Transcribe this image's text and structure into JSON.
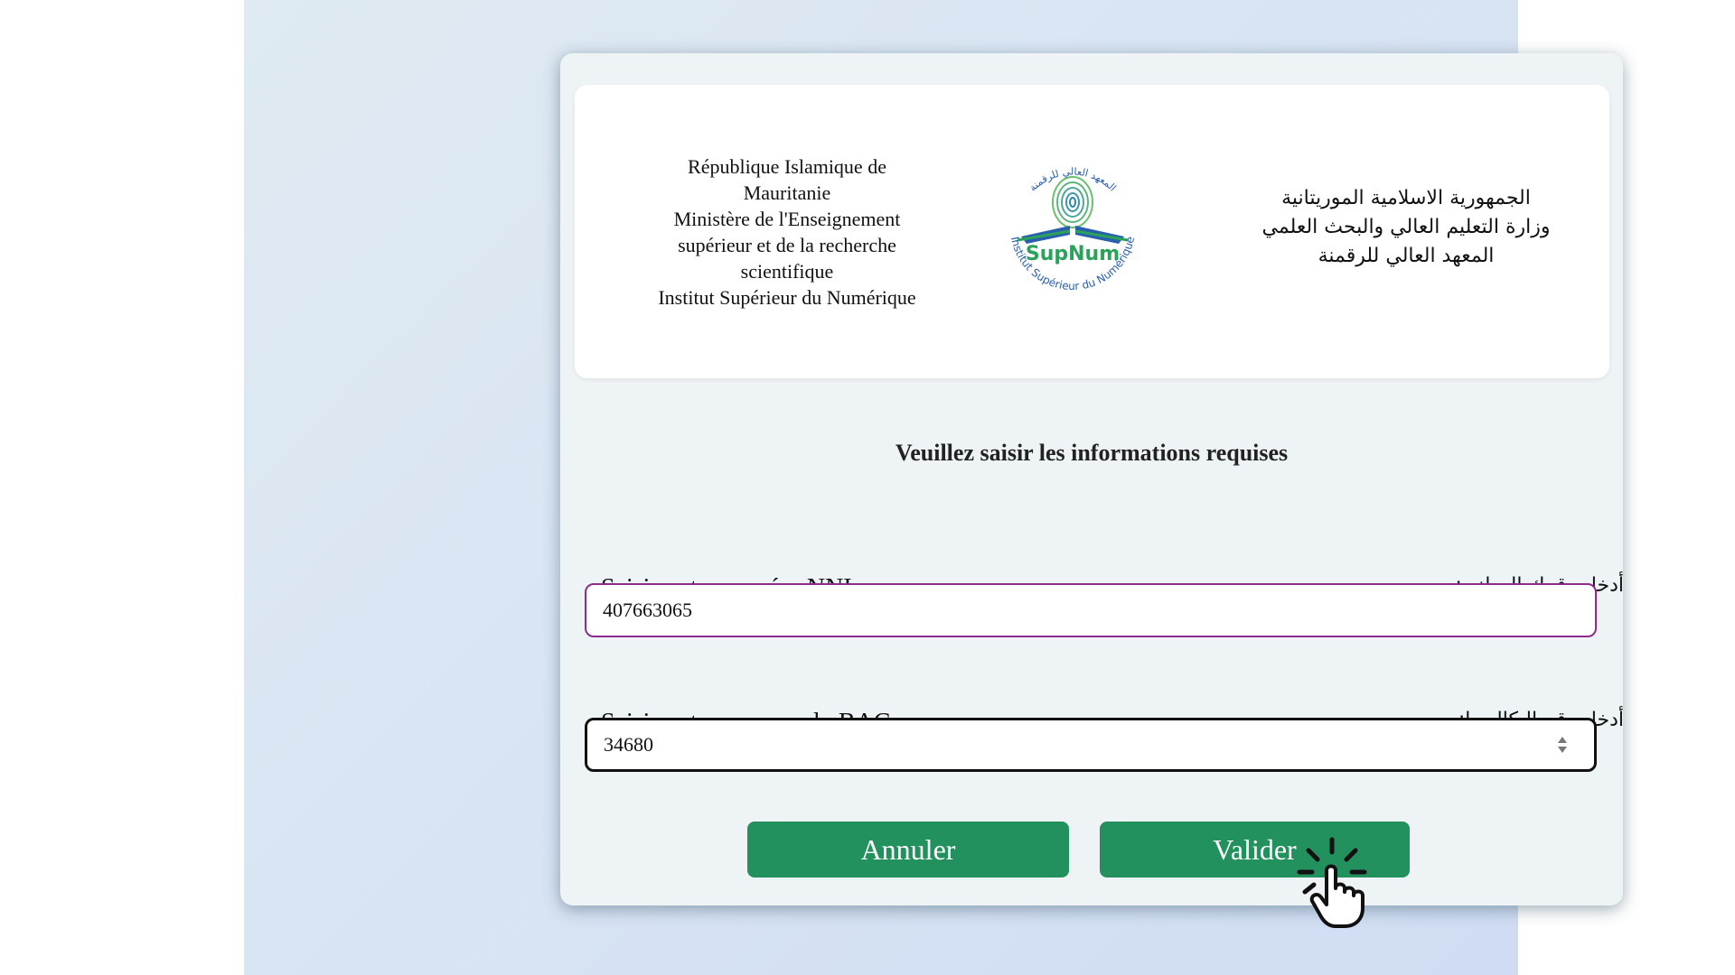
{
  "header": {
    "fr_lines": [
      "République Islamique de",
      "Mauritanie",
      "Ministère de l'Enseignement",
      "supérieur et de la recherche",
      "scientifique",
      "Institut Supérieur du Numérique"
    ],
    "ar_lines": [
      "الجمهورية الاسلامية الموريتانية",
      "وزارة التعليم العالي والبحث العلمي",
      "المعهد العالي للرقمنة"
    ],
    "logo": {
      "icon": "fingerprint-book-seal-icon",
      "wordmark": "SupNum",
      "ring_text_fr": "Institut Supérieur du Numérique",
      "ring_text_ar": "المعهد العالي للرقمنة",
      "colors": {
        "blue": "#2a5fae",
        "green": "#2aa25a",
        "teal": "#1e9a9a"
      }
    }
  },
  "form": {
    "title": "Veuillez saisir les informations requises",
    "nni": {
      "label_fr": "Saisir votre numéro NNI:",
      "label_ar": "أدخل رقمك الوطني:",
      "value": "407663065"
    },
    "bac": {
      "label_fr": "Saisir votre numero du BAC:",
      "label_ar": "أدخل رقم البكالوريا:",
      "value": "34680",
      "spinner_icon": "number-spinner-icon"
    },
    "buttons": {
      "cancel": "Annuler",
      "submit": "Valider"
    }
  },
  "colors": {
    "button": "#22915e",
    "nni_border": "#8e2c8e",
    "bac_border": "#111111"
  },
  "overlay": {
    "icon": "hand-click-cursor-icon"
  }
}
